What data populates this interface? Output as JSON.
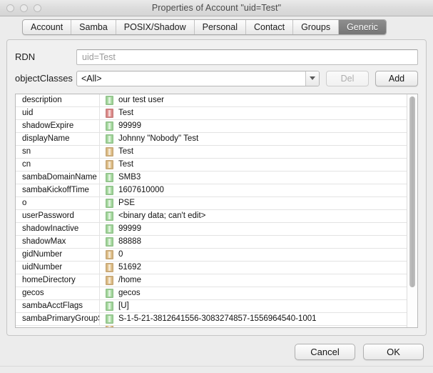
{
  "window": {
    "title": "Properties of Account \"uid=Test\"",
    "traffic_lights": [
      "close-button",
      "minimize-button",
      "zoom-button"
    ]
  },
  "tabs": [
    {
      "label": "Account",
      "selected": false
    },
    {
      "label": "Samba",
      "selected": false
    },
    {
      "label": "POSIX/Shadow",
      "selected": false
    },
    {
      "label": "Personal",
      "selected": false
    },
    {
      "label": "Contact",
      "selected": false
    },
    {
      "label": "Groups",
      "selected": false
    },
    {
      "label": "Generic",
      "selected": true
    }
  ],
  "form": {
    "rdn_label": "RDN",
    "rdn_value": "uid=Test",
    "objectclasses_label": "objectClasses",
    "objectclasses_value": "<All>",
    "del_label": "Del",
    "add_label": "Add"
  },
  "attributes": [
    {
      "name": "description",
      "icon": "green",
      "value": "our test user"
    },
    {
      "name": "uid",
      "icon": "red",
      "value": "Test"
    },
    {
      "name": "shadowExpire",
      "icon": "green",
      "value": "99999"
    },
    {
      "name": "displayName",
      "icon": "green",
      "value": "Johnny \"Nobody\" Test"
    },
    {
      "name": "sn",
      "icon": "orange",
      "value": "Test"
    },
    {
      "name": "cn",
      "icon": "orange",
      "value": "Test"
    },
    {
      "name": "sambaDomainName",
      "icon": "green",
      "value": "SMB3"
    },
    {
      "name": "sambaKickoffTime",
      "icon": "green",
      "value": "1607610000"
    },
    {
      "name": "o",
      "icon": "green",
      "value": "PSE"
    },
    {
      "name": "userPassword",
      "icon": "green",
      "value": "<binary data; can't edit>"
    },
    {
      "name": "shadowInactive",
      "icon": "green",
      "value": "99999"
    },
    {
      "name": "shadowMax",
      "icon": "green",
      "value": "88888"
    },
    {
      "name": "gidNumber",
      "icon": "orange",
      "value": "0"
    },
    {
      "name": "uidNumber",
      "icon": "orange",
      "value": "51692"
    },
    {
      "name": "homeDirectory",
      "icon": "orange",
      "value": "/home"
    },
    {
      "name": "gecos",
      "icon": "green",
      "value": "gecos"
    },
    {
      "name": "sambaAcctFlags",
      "icon": "green",
      "value": "[U]"
    },
    {
      "name": "sambaPrimaryGroupSID",
      "icon": "green",
      "value": "S-1-5-21-3812641556-3083274857-1556964540-1001"
    }
  ],
  "footer": {
    "cancel_label": "Cancel",
    "ok_label": "OK"
  }
}
